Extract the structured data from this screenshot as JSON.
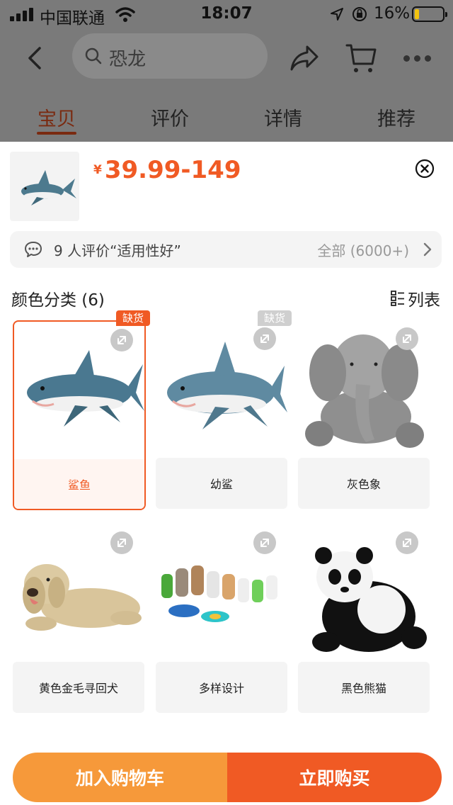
{
  "status_bar": {
    "carrier": "中国联通",
    "time": "18:07",
    "battery_percent": "16%",
    "battery_level": 0.16
  },
  "nav": {
    "search_text": "恐龙",
    "icons": [
      "back-icon",
      "search-icon",
      "share-icon",
      "cart-icon",
      "more-icon"
    ]
  },
  "tabs": [
    "宝贝",
    "评价",
    "详情",
    "推荐"
  ],
  "active_tab": 0,
  "product": {
    "currency": "¥",
    "price": "39.99-149"
  },
  "review_bar": {
    "text": "9 人评价“适用性好”",
    "all": "全部 (6000+)"
  },
  "category": {
    "heading": "颜色分类 (6)",
    "list_label": "列表"
  },
  "variants": [
    {
      "label": "鲨鱼",
      "badge": "缺货",
      "selected": true
    },
    {
      "label": "幼鲨",
      "badge": "缺货",
      "selected": false
    },
    {
      "label": "灰色象",
      "badge": "",
      "selected": false
    },
    {
      "label": "黄色金毛寻回犬",
      "badge": "",
      "selected": false
    },
    {
      "label": "多样设计",
      "badge": "",
      "selected": false
    },
    {
      "label": "黑色熊猫",
      "badge": "",
      "selected": false
    }
  ],
  "actions": {
    "add_to_cart": "加入购物车",
    "buy_now": "立即购买"
  },
  "colors": {
    "accent": "#f05a24",
    "cart_button": "#f6993a",
    "overlay": "#7a7a7a"
  }
}
